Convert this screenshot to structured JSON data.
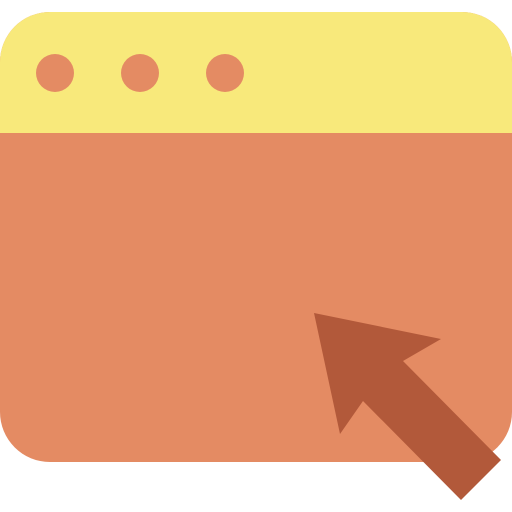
{
  "colors": {
    "background": "#FFFFFF",
    "titlebar": "#F8E97B",
    "window_body": "#E48B63",
    "dot": "#E48B63",
    "cursor": "#B2593A"
  },
  "icons": {
    "window": "browser-window-icon",
    "titlebar_dots": "window-control-dots-icon",
    "cursor": "cursor-arrow-icon"
  }
}
